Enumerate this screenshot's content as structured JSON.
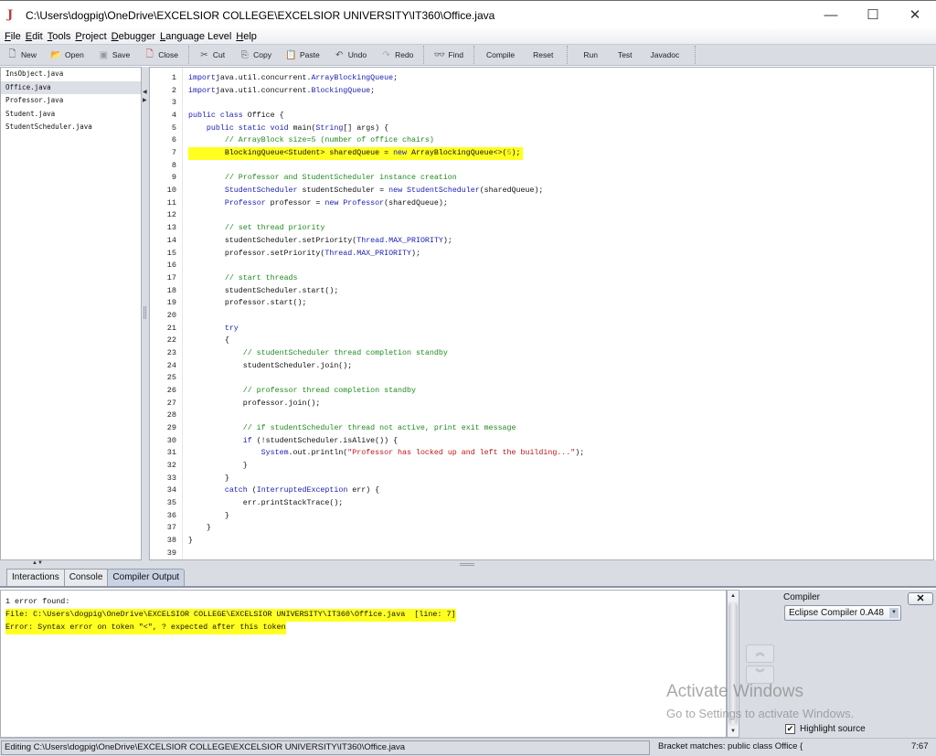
{
  "window": {
    "title": "C:\\Users\\dogpig\\OneDrive\\EXCELSIOR COLLEGE\\EXCELSIOR UNIVERSITY\\IT360\\Office.java",
    "minimize": "—",
    "maximize": "☐",
    "close": "✕"
  },
  "menu": [
    {
      "u": "F",
      "rest": "ile"
    },
    {
      "u": "E",
      "rest": "dit"
    },
    {
      "u": "T",
      "rest": "ools"
    },
    {
      "u": "P",
      "rest": "roject"
    },
    {
      "u": "D",
      "rest": "ebugger"
    },
    {
      "u": "L",
      "rest": "anguage Level"
    },
    {
      "u": "H",
      "rest": "elp"
    }
  ],
  "toolbar": {
    "new": "New",
    "open": "Open",
    "save": "Save",
    "close": "Close",
    "cut": "Cut",
    "copy": "Copy",
    "paste": "Paste",
    "undo": "Undo",
    "redo": "Redo",
    "find": "Find",
    "compile": "Compile",
    "reset": "Reset",
    "run": "Run",
    "test": "Test",
    "javadoc": "Javadoc"
  },
  "files": [
    {
      "name": "InsObject.java",
      "selected": false
    },
    {
      "name": "Office.java",
      "selected": true
    },
    {
      "name": "Professor.java",
      "selected": false
    },
    {
      "name": "Student.java",
      "selected": false
    },
    {
      "name": "StudentScheduler.java",
      "selected": false
    }
  ],
  "editor": {
    "highlighted_line": 7,
    "lines": [
      [
        [
          "kw",
          "import"
        ],
        [
          "",
          "java.util.concurrent."
        ],
        [
          "ty",
          "ArrayBlockingQueue"
        ],
        [
          "",
          ";"
        ]
      ],
      [
        [
          "kw",
          "import"
        ],
        [
          "",
          "java.util.concurrent."
        ],
        [
          "ty",
          "BlockingQueue"
        ],
        [
          "",
          ";"
        ]
      ],
      [],
      [
        [
          "kw",
          "public class"
        ],
        [
          "",
          " Office {"
        ]
      ],
      [
        [
          "",
          "    "
        ],
        [
          "kw",
          "public static void"
        ],
        [
          "",
          " main("
        ],
        [
          "ty",
          "String"
        ],
        [
          "",
          "[] args) {"
        ]
      ],
      [
        [
          "",
          "        "
        ],
        [
          "cm",
          "// ArrayBlock size=5 (number of office chairs)"
        ]
      ],
      [
        [
          "",
          "        BlockingQueue<Student> sharedQueue = "
        ],
        [
          "kw",
          "new"
        ],
        [
          "",
          " ArrayBlockingQueue<>("
        ],
        [
          "nm",
          "5"
        ],
        [
          "",
          ");"
        ]
      ],
      [],
      [
        [
          "",
          "        "
        ],
        [
          "cm",
          "// Professor and StudentScheduler instance creation"
        ]
      ],
      [
        [
          "",
          "        "
        ],
        [
          "ty",
          "StudentScheduler"
        ],
        [
          "",
          " studentScheduler = "
        ],
        [
          "kw",
          "new"
        ],
        [
          "",
          ""
        ],
        [
          "ty",
          " StudentScheduler"
        ],
        [
          "",
          "(sharedQueue);"
        ]
      ],
      [
        [
          "",
          "        "
        ],
        [
          "ty",
          "Professor"
        ],
        [
          "",
          " professor = "
        ],
        [
          "kw",
          "new"
        ],
        [
          "ty",
          " Professor"
        ],
        [
          "",
          "(sharedQueue);"
        ]
      ],
      [],
      [
        [
          "",
          "        "
        ],
        [
          "cm",
          "// set thread priority"
        ]
      ],
      [
        [
          "",
          "        studentScheduler.setPriority("
        ],
        [
          "ty",
          "Thread.MAX_PRIORITY"
        ],
        [
          "",
          ");"
        ]
      ],
      [
        [
          "",
          "        professor.setPriority("
        ],
        [
          "ty",
          "Thread.MAX_PRIORITY"
        ],
        [
          "",
          ");"
        ]
      ],
      [],
      [
        [
          "",
          "        "
        ],
        [
          "cm",
          "// start threads"
        ]
      ],
      [
        [
          "",
          "        studentScheduler.start();"
        ]
      ],
      [
        [
          "",
          "        professor.start();"
        ]
      ],
      [],
      [
        [
          "",
          "        "
        ],
        [
          "kw",
          "try"
        ]
      ],
      [
        [
          "",
          "        {"
        ]
      ],
      [
        [
          "",
          "            "
        ],
        [
          "cm",
          "// studentScheduler thread completion standby"
        ]
      ],
      [
        [
          "",
          "            studentScheduler.join();"
        ]
      ],
      [],
      [
        [
          "",
          "            "
        ],
        [
          "cm",
          "// professor thread completion standby"
        ]
      ],
      [
        [
          "",
          "            professor.join();"
        ]
      ],
      [],
      [
        [
          "",
          "            "
        ],
        [
          "cm",
          "// if studentScheduler thread not active, print exit message"
        ]
      ],
      [
        [
          "",
          "            "
        ],
        [
          "kw",
          "if"
        ],
        [
          "",
          " (!studentScheduler.isAlive()) {"
        ]
      ],
      [
        [
          "",
          "                "
        ],
        [
          "ty",
          "System"
        ],
        [
          "",
          ".out.println("
        ],
        [
          "st",
          "\"Professor has locked up and left the building...\""
        ],
        [
          "",
          ");"
        ]
      ],
      [
        [
          "",
          "            }"
        ]
      ],
      [
        [
          "",
          "        }"
        ]
      ],
      [
        [
          "",
          "        "
        ],
        [
          "kw",
          "catch"
        ],
        [
          "",
          " ("
        ],
        [
          "ty",
          "InterruptedException"
        ],
        [
          "",
          " err) {"
        ]
      ],
      [
        [
          "",
          "            err.printStackTrace();"
        ]
      ],
      [
        [
          "",
          "        }"
        ]
      ],
      [
        [
          "",
          "    }"
        ]
      ],
      [
        [
          "",
          "}"
        ]
      ],
      []
    ]
  },
  "tabs": [
    {
      "label": "Interactions",
      "active": false
    },
    {
      "label": "Console",
      "active": false
    },
    {
      "label": "Compiler Output",
      "active": true
    }
  ],
  "output": {
    "summary": "1 error found:",
    "file_line": "File: C:\\Users\\dogpig\\OneDrive\\EXCELSIOR COLLEGE\\EXCELSIOR UNIVERSITY\\IT360\\Office.java  [line: 7]",
    "error_line": "Error: Syntax error on token \"<\", ? expected after this token"
  },
  "compiler_panel": {
    "label": "Compiler",
    "selected": "Eclipse Compiler 0.A48",
    "close": "✕",
    "prev": "︽",
    "next": "︾",
    "highlight_source_label": "Highlight source",
    "highlight_source_checked": true
  },
  "watermark": {
    "line1": "Activate Windows",
    "line2": "Go to Settings to activate Windows."
  },
  "status": {
    "editing": "Editing C:\\Users\\dogpig\\OneDrive\\EXCELSIOR COLLEGE\\EXCELSIOR UNIVERSITY\\IT360\\Office.java",
    "bracket": "Bracket matches: public class Office {",
    "position": "7:67"
  }
}
